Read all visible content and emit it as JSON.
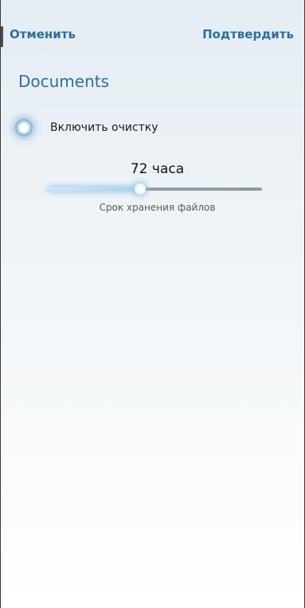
{
  "topbar": {
    "cancel_label": "Отменить",
    "confirm_label": "Подтвердить"
  },
  "section": {
    "title": "Documents"
  },
  "cleanup": {
    "toggle_label": "Включить очистку",
    "selected": false
  },
  "retention": {
    "value_label": "72 часа",
    "caption": "Срок хранения файлов",
    "fraction": 0.43
  },
  "colors": {
    "accent": "#2b6ea3",
    "title": "#2f6e9e"
  }
}
